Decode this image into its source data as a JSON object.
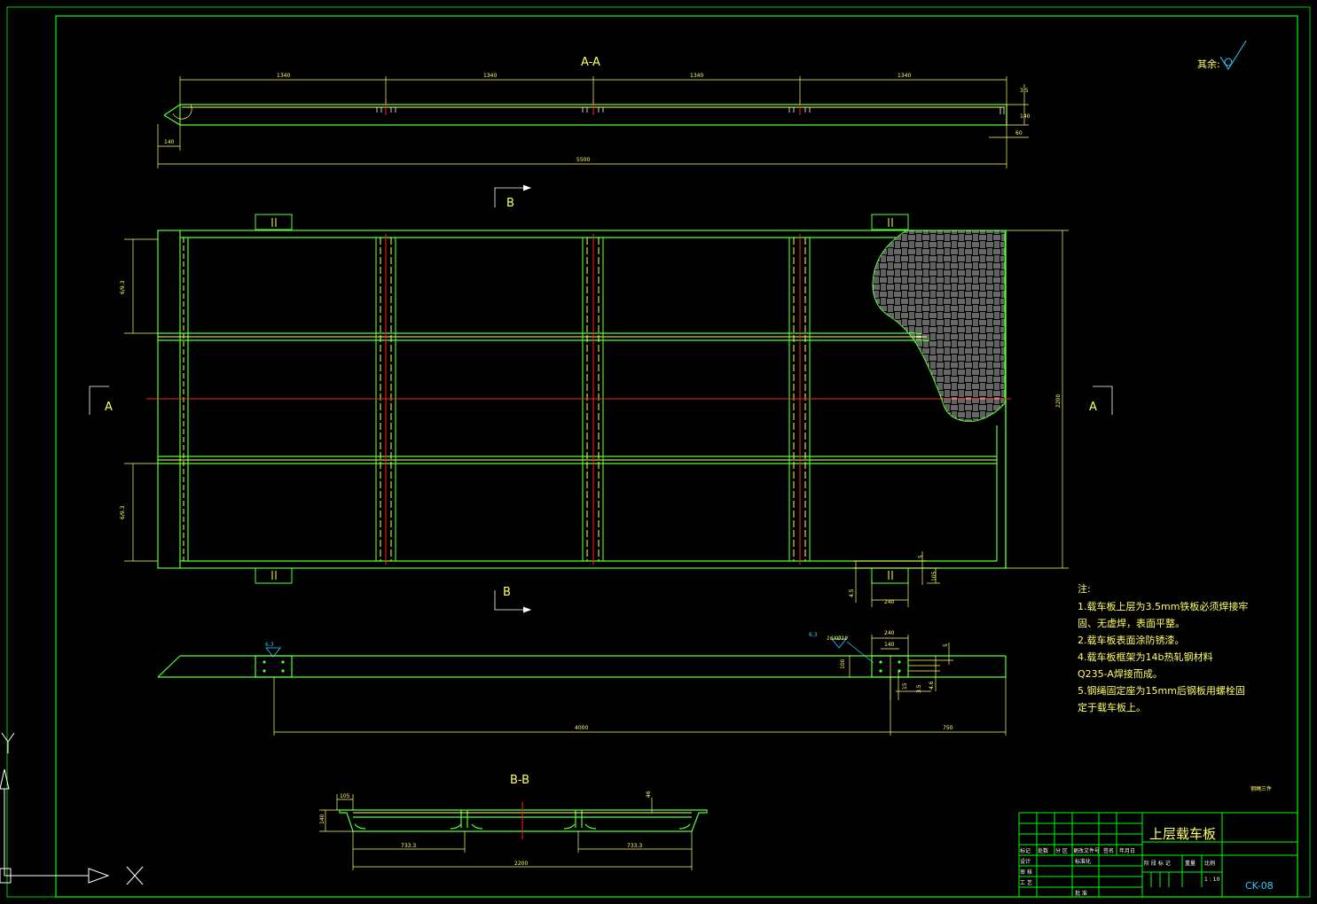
{
  "section_aa": {
    "title": "A-A",
    "spacing_labels": [
      "1340",
      "1340",
      "1340",
      "1340"
    ],
    "overall_length": "5500",
    "left_offset": "140",
    "right_offset": "60",
    "height_top": "3.5",
    "height_total": "140"
  },
  "roughness_note": "其余:",
  "plan_view": {
    "section_b_label": "B",
    "section_a_label": "A",
    "left_dim_top": "6/9.3",
    "left_dim_bottom": "6/9.3",
    "right_dim": "2200",
    "detail_dims": [
      "5",
      "105",
      "4.5",
      "240"
    ]
  },
  "side_view": {
    "weld_left": "6.3",
    "weld_right": "6.3",
    "bolt_spec": "16XØ18",
    "dims": [
      "240",
      "140",
      "5",
      "15",
      "3.5",
      "4.6",
      "100"
    ],
    "length_a": "4000",
    "length_b": "750"
  },
  "section_bb": {
    "title": "B-B",
    "dim_left_w": "105",
    "dim_left_h": "140",
    "dim_right_h": "46",
    "dim_span_left": "733.3",
    "dim_span_right": "733.3",
    "dim_total": "2200"
  },
  "notes": {
    "heading": "注:",
    "lines": [
      "1.载车板上层为3.5mm铁板必须焊接牢",
      "固、无虚焊，表面平整。",
      "2.载车板表面涂防锈漆。",
      "4.载车板框架为14b热轧钢材料",
      "Q235-A焊接而成。",
      "5.钢绳固定座为15mm后钢板用螺栓固",
      "定于载车板上。"
    ]
  },
  "corner_note": "钢绳三件",
  "title_block": {
    "title": "上层载车板",
    "drawing_no": "CK-08",
    "cells": [
      "标记",
      "处数",
      "分 区",
      "更改文件号",
      "签名",
      "年月日",
      "设计",
      "标准化",
      "阶 段 标 记",
      "重量",
      "比例",
      "审 核",
      "工 艺",
      "批 准",
      "1 : 10"
    ]
  },
  "ucs": {
    "x": "X",
    "y": "Y"
  },
  "colors": {
    "frame": "#00ff00",
    "line": "#55ff33",
    "dim": "#ffff66",
    "text": "#ffff66",
    "center": "#ff2222",
    "cyan": "#33ccff",
    "white": "#ffffff"
  }
}
